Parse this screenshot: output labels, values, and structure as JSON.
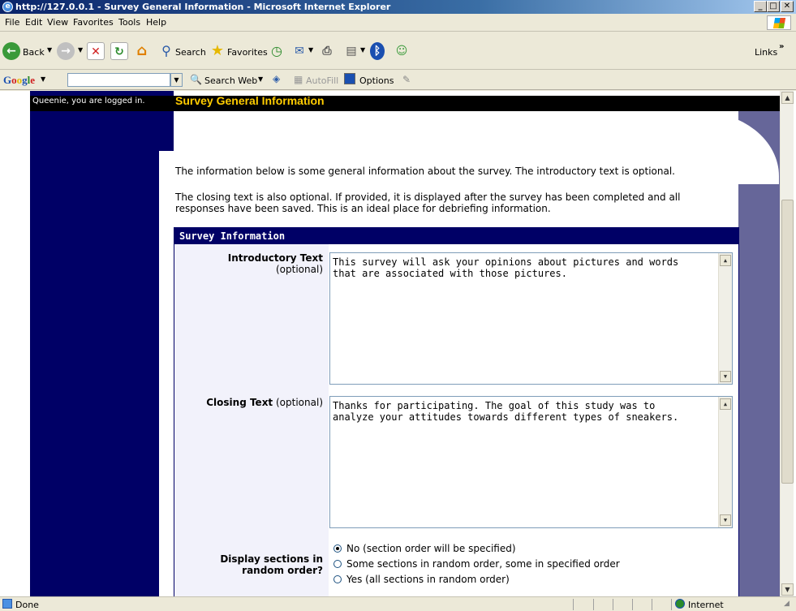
{
  "window": {
    "title": "http://127.0.0.1 - Survey General Information - Microsoft Internet Explorer"
  },
  "menu": [
    "File",
    "Edit",
    "View",
    "Favorites",
    "Tools",
    "Help"
  ],
  "toolbar": {
    "back": "Back",
    "search": "Search",
    "favorites": "Favorites",
    "links": "Links"
  },
  "google": {
    "logo": "Google",
    "search_web": "Search Web",
    "autofill": "AutoFill",
    "options": "Options"
  },
  "page": {
    "logged_in": "Queenie, you are logged in.",
    "title": "Survey General Information",
    "intro1": "The information below is some general information about the survey. The introductory text is optional.",
    "intro2a": "The closing text is also optional. If provided, it is displayed after the survey has been completed and all",
    "intro2b": "responses have been saved. This is an ideal place for debriefing information."
  },
  "section": {
    "header": "Survey Information",
    "intro_label": "Introductory Text",
    "intro_opt": "(optional)",
    "intro_value_1": "This survey will ask your opinions about pictures and words",
    "intro_value_2": "that are associated with those pictures.",
    "closing_label": "Closing Text",
    "closing_opt": "(optional)",
    "closing_value_1": "Thanks for participating. The goal of this study was to",
    "closing_value_2": "analyze your attitudes towards different types of sneakers.",
    "random_label_1": "Display sections in",
    "random_label_2": "random order?",
    "radios": [
      {
        "label": "No (section order will be specified)",
        "checked": true
      },
      {
        "label": "Some sections in random order, some in specified order",
        "checked": false
      },
      {
        "label": "Yes (all sections in random order)",
        "checked": false
      }
    ]
  },
  "status": {
    "text": "Done",
    "zone": "Internet"
  }
}
